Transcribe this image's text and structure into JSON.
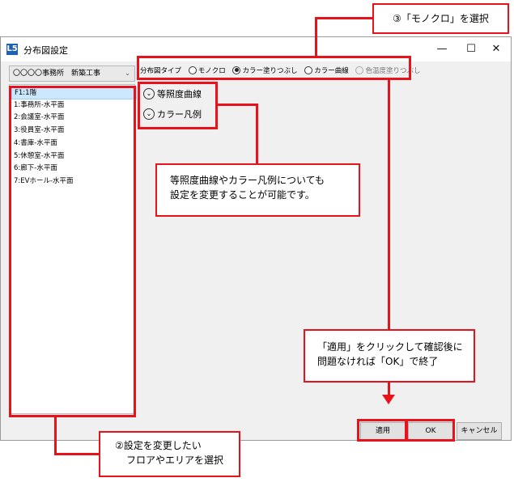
{
  "window": {
    "title": "分布図設定",
    "app_icon_glyph": "L5",
    "controls": {
      "minimize": "—",
      "maximize": "☐",
      "close": "✕"
    }
  },
  "left_panel": {
    "project_selector": "〇〇〇〇事務所　新築工事",
    "items": [
      "F1:1階",
      "1:事務所-水平面",
      "2:会議室-水平面",
      "3:役員室-水平面",
      "4:書庫-水平面",
      "5:休憩室-水平面",
      "6:廊下-水平面",
      "7:EVホール-水平面"
    ],
    "selected_index": 0
  },
  "right_panel": {
    "type_label": "分布図タイプ",
    "radios": [
      {
        "label": "モノクロ",
        "checked": false,
        "disabled": false
      },
      {
        "label": "カラー塗りつぶし",
        "checked": true,
        "disabled": false
      },
      {
        "label": "カラー曲線",
        "checked": false,
        "disabled": false
      },
      {
        "label": "色温度塗りつぶし",
        "checked": false,
        "disabled": true
      }
    ],
    "sections": [
      "等照度曲線",
      "カラー凡例"
    ]
  },
  "buttons": {
    "apply": "適用",
    "ok": "OK",
    "cancel": "キャンセル"
  },
  "annotations": {
    "step3": "③「モノクロ」を選択",
    "middle_line1": "等照度曲線やカラー凡例についても",
    "middle_line2": "設定を変更することが可能です。",
    "apply_line1": "「適用」をクリックして確認後に",
    "apply_line2": "問題なければ「OK」で終了",
    "step2_line1": "②設定を変更したい",
    "step2_line2": "フロアやエリアを選択"
  },
  "colors": {
    "annotation_red": "#e8121b",
    "selection_blue": "#cce8ff"
  }
}
